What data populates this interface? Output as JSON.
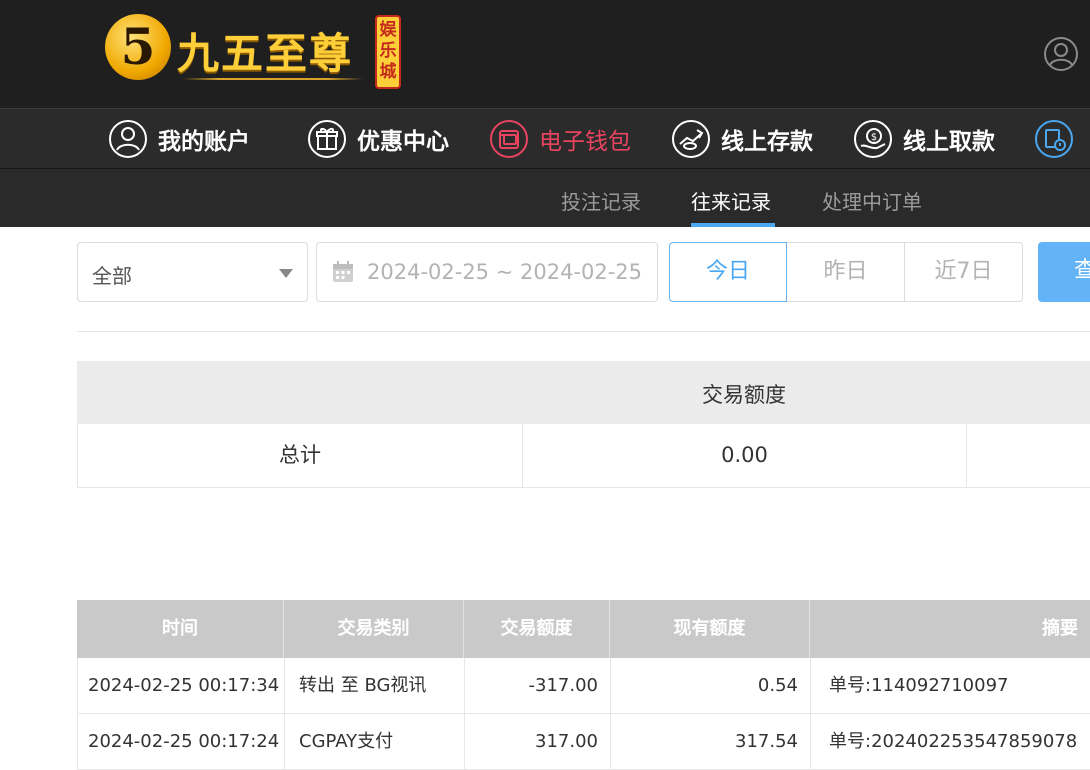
{
  "header": {
    "logo_digit": "5",
    "logo_text": "九五至尊",
    "logo_badge": "娱乐城"
  },
  "nav": {
    "items": [
      {
        "label": "我的账户",
        "icon": "user-icon"
      },
      {
        "label": "优惠中心",
        "icon": "gift-icon"
      },
      {
        "label": "电子钱包",
        "icon": "wallet-icon"
      },
      {
        "label": "线上存款",
        "icon": "deposit-icon"
      },
      {
        "label": "线上取款",
        "icon": "withdraw-icon"
      }
    ],
    "active_color": "#e8445f"
  },
  "subnav": {
    "tabs": [
      {
        "label": "投注记录"
      },
      {
        "label": "往来记录"
      },
      {
        "label": "处理中订单"
      }
    ],
    "accent": "#4aa7f0"
  },
  "filters": {
    "type_value": "全部",
    "date_range": "2024-02-25 ~ 2024-02-25",
    "quick": [
      "今日",
      "昨日",
      "近7日"
    ],
    "search_label": "查"
  },
  "summary": {
    "header": "交易额度",
    "total_label": "总计",
    "total_value": "0.00"
  },
  "table": {
    "headers": [
      "时间",
      "交易类别",
      "交易额度",
      "现有额度",
      "摘要"
    ],
    "rows": [
      [
        "2024-02-25 00:17:34",
        "转出 至 BG视讯",
        "-317.00",
        "0.54",
        "单号:114092710097"
      ],
      [
        "2024-02-25 00:17:24",
        "CGPAY支付",
        "317.00",
        "317.54",
        "单号:20240225354785907​8"
      ]
    ]
  }
}
